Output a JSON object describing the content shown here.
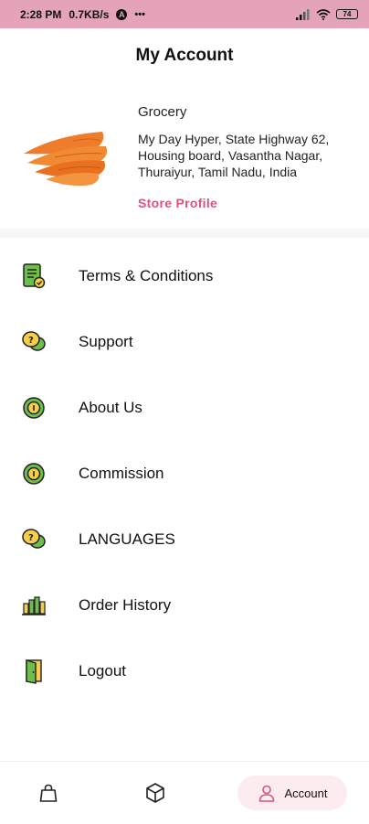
{
  "status_bar": {
    "time": "2:28 PM",
    "speed": "0.7KB/s",
    "app_badge": "A",
    "battery": "74"
  },
  "header": {
    "title": "My Account"
  },
  "store": {
    "category": "Grocery",
    "address": "My Day Hyper, State Highway 62, Housing board, Vasantha Nagar, Thuraiyur, Tamil Nadu, India",
    "profile_link": "Store Profile",
    "image": "carrots-image"
  },
  "menu": [
    {
      "label": "Terms & Conditions",
      "icon": "terms-document-icon"
    },
    {
      "label": "Support",
      "icon": "support-chat-icon"
    },
    {
      "label": "About Us",
      "icon": "about-info-icon"
    },
    {
      "label": "Commission",
      "icon": "commission-coin-icon"
    },
    {
      "label": "LANGUAGES",
      "icon": "languages-chat-icon"
    },
    {
      "label": "Order History",
      "icon": "order-history-chart-icon"
    },
    {
      "label": "Logout",
      "icon": "logout-door-icon"
    }
  ],
  "bottom_nav": {
    "items": [
      {
        "icon": "shopping-bag-icon",
        "label": ""
      },
      {
        "icon": "package-box-icon",
        "label": ""
      },
      {
        "icon": "user-icon",
        "label": "Account",
        "active": true
      }
    ]
  },
  "colors": {
    "status_bar": "#e4a3b8",
    "accent": "#d6567a",
    "active_tab_bg": "#fcebef",
    "icon_green": "#6cc04a",
    "icon_yellow": "#f5cf4a"
  }
}
